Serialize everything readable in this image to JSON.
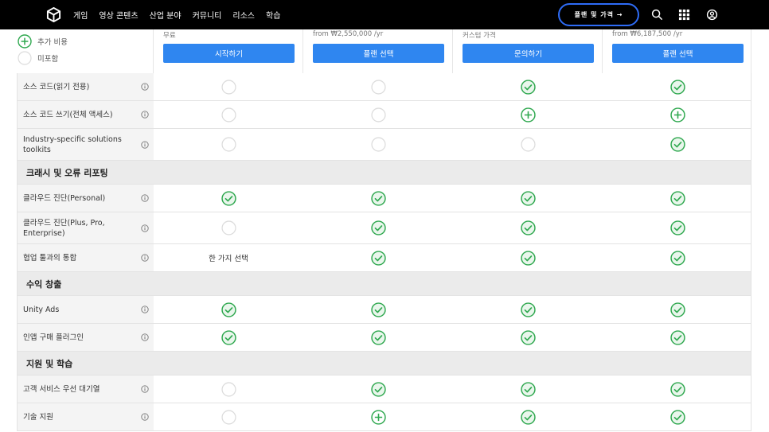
{
  "nav": {
    "links": [
      "게임",
      "영상 콘텐츠",
      "산업 분야",
      "커뮤니티",
      "리소스",
      "학습"
    ],
    "plans_button": "플랜 및 가격 →"
  },
  "legend": {
    "additional": "추가 비용",
    "not_included": "미포함"
  },
  "plans": [
    {
      "price": "무료",
      "cta": "시작하기"
    },
    {
      "price": "from ₩2,550,000 /yr",
      "cta": "플랜 선택"
    },
    {
      "price": "커스텀 가격",
      "cta": "문의하기"
    },
    {
      "price": "from ₩6,187,500 /yr",
      "cta": "플랜 선택"
    }
  ],
  "rows": [
    {
      "kind": "feature",
      "label": "소스 코드(읽기 전용)",
      "cells": [
        "none",
        "none",
        "check",
        "check"
      ]
    },
    {
      "kind": "feature",
      "label": "소스 코드 쓰기(전체 액세스)",
      "cells": [
        "none",
        "none",
        "plus",
        "plus"
      ]
    },
    {
      "kind": "feature",
      "label": "Industry-specific solutions toolkits",
      "tall": true,
      "cells": [
        "none",
        "none",
        "none",
        "check"
      ]
    },
    {
      "kind": "section",
      "label": "크래시 및 오류 리포팅"
    },
    {
      "kind": "feature",
      "label": "클라우드 진단(Personal)",
      "cells": [
        "check",
        "check",
        "check",
        "check"
      ]
    },
    {
      "kind": "feature",
      "label": "클라우드 진단(Plus, Pro, Enterprise)",
      "tall": true,
      "cells": [
        "none",
        "check",
        "check",
        "check"
      ]
    },
    {
      "kind": "feature",
      "label": "협업 툴과의 통합",
      "cells": [
        "한 가지 선택",
        "check",
        "check",
        "check"
      ]
    },
    {
      "kind": "section",
      "label": "수익 창출"
    },
    {
      "kind": "feature",
      "label": "Unity Ads",
      "cells": [
        "check",
        "check",
        "check",
        "check"
      ]
    },
    {
      "kind": "feature",
      "label": "인앱 구매 플러그인",
      "cells": [
        "check",
        "check",
        "check",
        "check"
      ]
    },
    {
      "kind": "section",
      "label": "지원 및 학습"
    },
    {
      "kind": "feature",
      "label": "고객 서비스 우선 대기열",
      "cells": [
        "none",
        "check",
        "check",
        "check"
      ]
    },
    {
      "kind": "feature",
      "label": "기술 지원",
      "cells": [
        "none",
        "plus",
        "check",
        "check"
      ]
    }
  ],
  "colors": {
    "accent": "#2f86f0",
    "check": "#2fa84f",
    "nav_bg": "#000000",
    "nav_border": "#2e6cf6"
  }
}
